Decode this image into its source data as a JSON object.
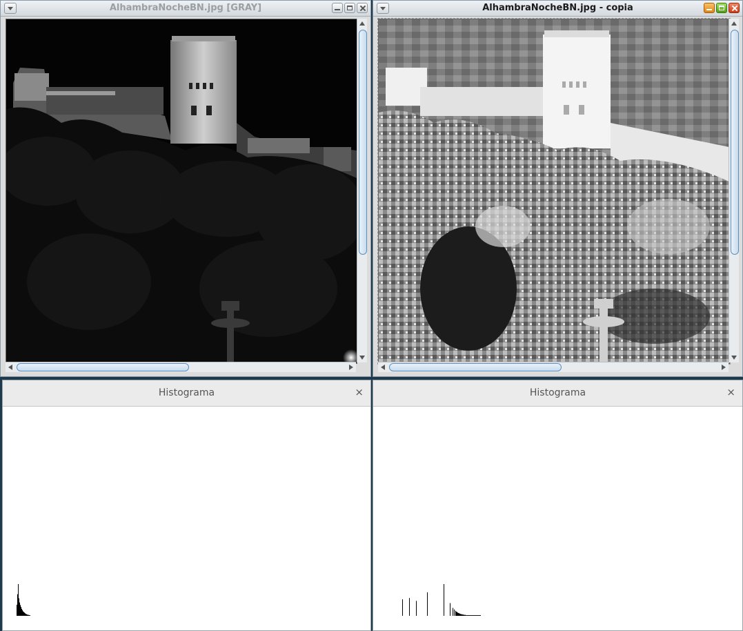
{
  "windows": {
    "left": {
      "title": "AlhambraNocheBN.jpg [GRAY]"
    },
    "right": {
      "title": "AlhambraNocheBN.jpg - copia"
    }
  },
  "icons": {
    "menu": "chevron-down-icon",
    "minimize": "minimize-icon",
    "maximize": "maximize-icon",
    "close": "close-icon"
  },
  "histograms": {
    "left": {
      "title": "Histograma",
      "close": "×",
      "bars": [
        0.35,
        0.68,
        1.0,
        0.55,
        0.42,
        0.34,
        0.28,
        0.22,
        0.18,
        0.14,
        0.12,
        0.1,
        0.08,
        0.06,
        0.05,
        0.04,
        0.03,
        0.03,
        0.02,
        0.02
      ]
    },
    "right": {
      "title": "Histograma",
      "close": "×",
      "bars": [
        0.52,
        0,
        0,
        0,
        0,
        0,
        0,
        0,
        0,
        0,
        0.56,
        0,
        0,
        0,
        0,
        0,
        0,
        0,
        0,
        0,
        0.47,
        0,
        0,
        0,
        0,
        0,
        0,
        0,
        0,
        0,
        0,
        0,
        0,
        0,
        0,
        0,
        0.74,
        0,
        0,
        0,
        0,
        0,
        0,
        0,
        0,
        0,
        0,
        0,
        0,
        0,
        0,
        0,
        0,
        0,
        0,
        0,
        0,
        0,
        0,
        0,
        1.0,
        0,
        0,
        0,
        0,
        0,
        0,
        0,
        0,
        0.4,
        0,
        0,
        0,
        0.25,
        0,
        0.2,
        0,
        0.16,
        0.13,
        0.12,
        0.1,
        0.09,
        0.08,
        0.07,
        0.06,
        0.05,
        0.05,
        0.04,
        0.04,
        0.03,
        0.03,
        0.03,
        0.02,
        0.02,
        0.02,
        0.02,
        0.02,
        0.02,
        0.02,
        0.02,
        0.02,
        0.02,
        0.02,
        0.02,
        0.02,
        0.02,
        0.02,
        0.02,
        0.02,
        0.02,
        0.02,
        0.02,
        0.02,
        0.02
      ]
    }
  },
  "colors": {
    "desktop": "#1e3a4c",
    "histogram_bar": "#000000"
  }
}
